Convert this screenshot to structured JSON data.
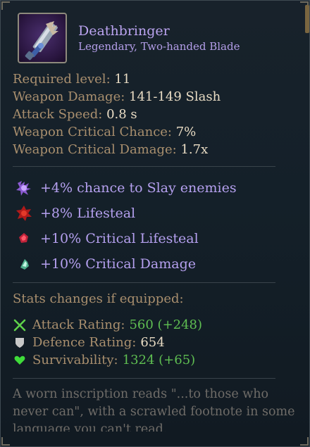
{
  "item": {
    "name": "Deathbringer",
    "type_line": "Legendary, Two-handed Blade",
    "icon": "cleaver-blade-icon"
  },
  "base_stats": [
    {
      "label": "Required level:",
      "value": "11"
    },
    {
      "label": "Weapon Damage:",
      "value": "141-149 Slash"
    },
    {
      "label": "Attack Speed:",
      "value": "0.8 s"
    },
    {
      "label": "Weapon Critical Chance:",
      "value": "7%"
    },
    {
      "label": "Weapon Critical Damage:",
      "value": "1.7x"
    }
  ],
  "affixes": [
    {
      "text": "+4% chance to Slay enemies",
      "icon": "slay-skull-icon"
    },
    {
      "text": "+8% Lifesteal",
      "icon": "lifesteal-icon"
    },
    {
      "text": "+10% Critical Lifesteal",
      "icon": "critical-lifesteal-icon"
    },
    {
      "text": "+10% Critical Damage",
      "icon": "critical-damage-icon"
    }
  ],
  "equip": {
    "title": "Stats changes if equipped:",
    "lines": [
      {
        "label": "Attack Rating:",
        "value": "560 (+248)",
        "icon": "crossed-swords-icon"
      },
      {
        "label": "Defence Rating:",
        "value": "654",
        "icon": "shield-icon"
      },
      {
        "label": "Survivability:",
        "value": "1324 (+65)",
        "icon": "heart-icon"
      }
    ]
  },
  "lore": "A worn inscription reads \"...to those who never can\", with a scrawled footnote in some language you can't read.",
  "colors": {
    "name": "#bba4f0",
    "stat_label": "#a98f6e",
    "stat_value": "#e9dcc4",
    "affix": "#b5a0ef",
    "positive": "#5fbf52",
    "lore": "#6f6c68"
  }
}
